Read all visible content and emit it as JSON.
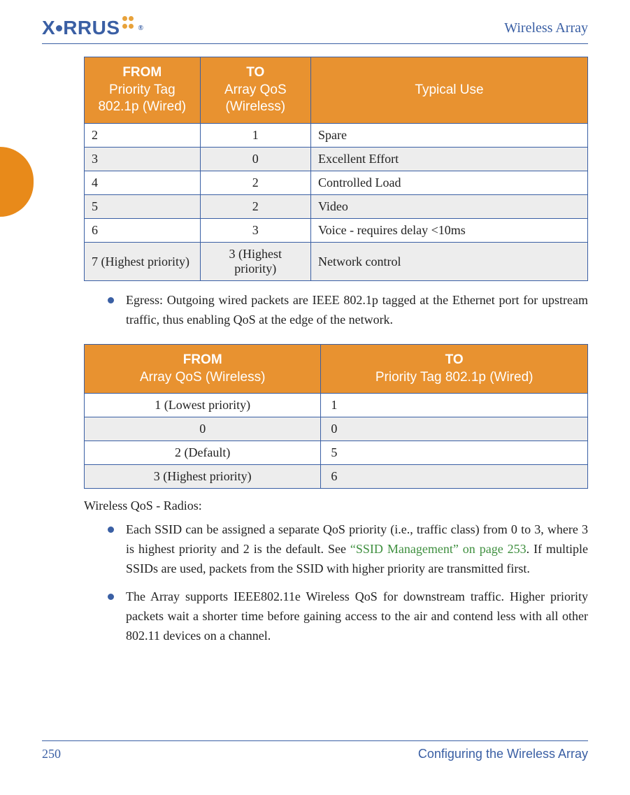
{
  "colors": {
    "accent_blue": "#3a5fa4",
    "accent_orange": "#e89230",
    "link_green": "#3f8f3f"
  },
  "header": {
    "brand": "XIRRUS",
    "doc_title": "Wireless Array"
  },
  "table1": {
    "headers": {
      "col1_line1": "FROM",
      "col1_line2": "Priority Tag 802.1p (Wired)",
      "col2_line1": "TO",
      "col2_line2": "Array QoS (Wireless)",
      "col3": "Typical Use"
    },
    "rows": [
      {
        "from": "2",
        "to": "1",
        "use": "Spare"
      },
      {
        "from": "3",
        "to": "0",
        "use": "Excellent Effort"
      },
      {
        "from": "4",
        "to": "2",
        "use": "Controlled Load"
      },
      {
        "from": "5",
        "to": "2",
        "use": "Video"
      },
      {
        "from": "6",
        "to": "3",
        "use": "Voice - requires delay <10ms"
      },
      {
        "from": "7 (Highest priority)",
        "to": "3 (Highest priority)",
        "use": "Network control"
      }
    ]
  },
  "egress_bullet": "Egress: Outgoing wired packets are IEEE 802.1p tagged at the Ethernet port for upstream traffic, thus enabling QoS at the edge of the network.",
  "table2": {
    "headers": {
      "col1_line1": "FROM",
      "col1_line2": "Array QoS (Wireless)",
      "col2_line1": "TO",
      "col2_line2": "Priority Tag 802.1p (Wired)"
    },
    "rows": [
      {
        "from": "1 (Lowest priority)",
        "to": "1"
      },
      {
        "from": "0",
        "to": "0"
      },
      {
        "from": "2 (Default)",
        "to": "5"
      },
      {
        "from": "3 (Highest priority)",
        "to": "6"
      }
    ]
  },
  "wireless_qos_heading": "Wireless QoS - Radios:",
  "ssid_bullet_pre": "Each SSID can be assigned a separate QoS priority (i.e., traffic class) from 0 to 3, where 3 is highest priority and 2 is the default. See ",
  "ssid_link": "“SSID Management” on page 253",
  "ssid_bullet_post": ". If multiple SSIDs are used, packets from the SSID with higher priority are transmitted first.",
  "ieee_bullet": "The Array supports IEEE802.11e Wireless QoS for downstream traffic. Higher priority packets wait a shorter time before gaining access to the air and contend less with all other 802.11 devices on a channel.",
  "footer": {
    "page_number": "250",
    "section": "Configuring the Wireless Array"
  }
}
